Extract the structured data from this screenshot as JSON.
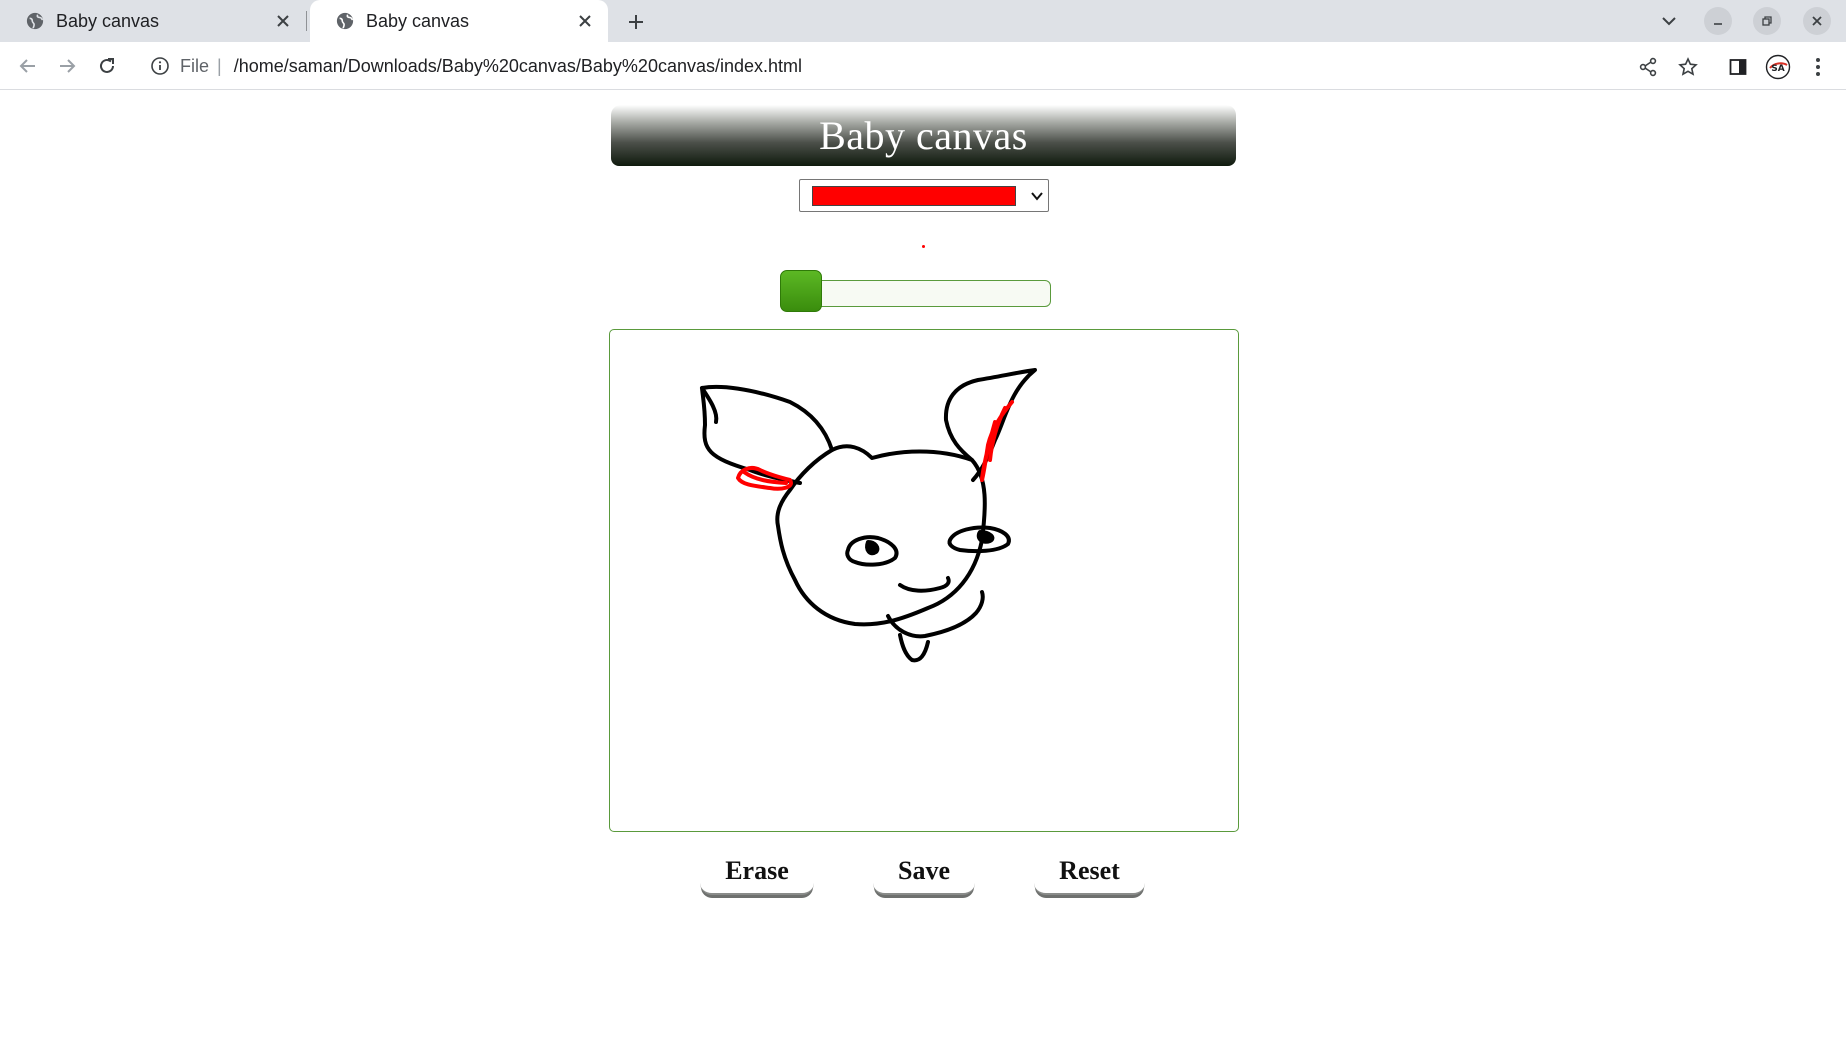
{
  "browser": {
    "tabs": [
      {
        "title": "Baby canvas",
        "active": false,
        "icon": "globe-icon"
      },
      {
        "title": "Baby canvas",
        "active": true,
        "icon": "globe-icon"
      }
    ],
    "address": {
      "scheme_label": "File",
      "separator": "|",
      "url": "/home/saman/Downloads/Baby%20canvas/Baby%20canvas/index.html"
    }
  },
  "app": {
    "title": "Baby canvas",
    "brush_color": "#ff0000",
    "brush_size_level": 0,
    "buttons": {
      "erase": "Erase",
      "save": "Save",
      "reset": "Reset"
    },
    "colors": {
      "frame_green": "#5a9a3c",
      "thumb_green": "#4aa616",
      "stroke_black": "#000000",
      "stroke_red": "#ff0000"
    }
  }
}
